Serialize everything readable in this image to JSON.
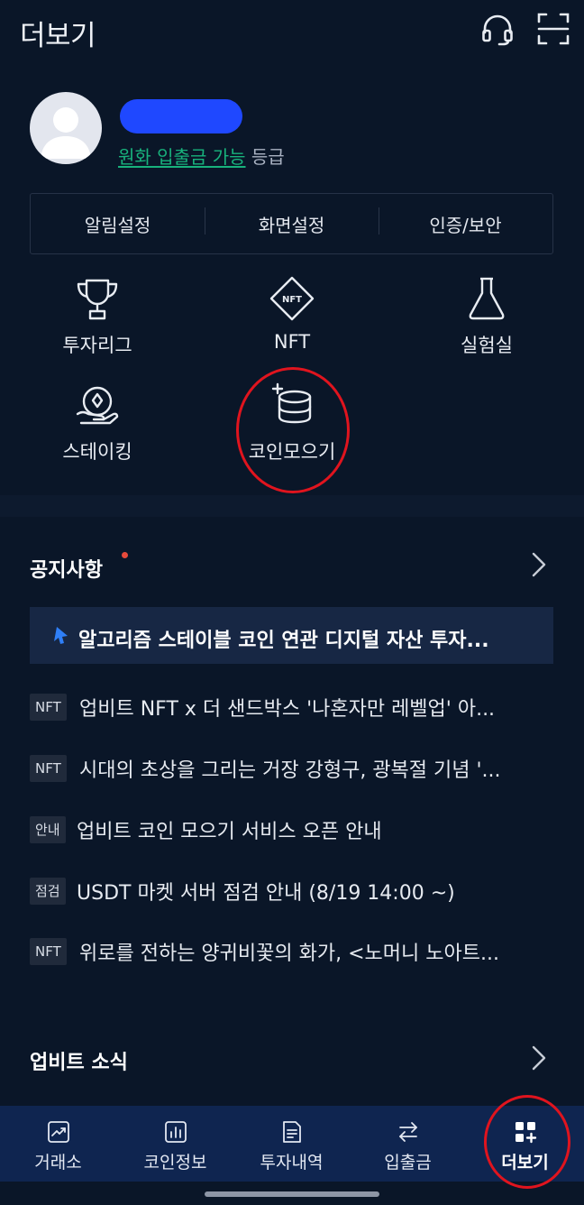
{
  "header": {
    "title": "더보기",
    "support_icon": "headset-icon",
    "scan_icon": "qr-scan-icon"
  },
  "profile": {
    "grade_link": "원화 입출금 가능",
    "grade_suffix": " 등급"
  },
  "settings": [
    "알림설정",
    "화면설정",
    "인증/보안"
  ],
  "features": [
    {
      "label": "투자리그",
      "icon": "trophy-icon"
    },
    {
      "label": "NFT",
      "icon": "nft-icon",
      "icon_text": "NFT"
    },
    {
      "label": "실험실",
      "icon": "flask-icon"
    },
    {
      "label": "스테이킹",
      "icon": "staking-icon"
    },
    {
      "label": "코인모으기",
      "icon": "coin-stack-icon"
    }
  ],
  "notice_section": {
    "title": "공지사항",
    "pinned": "알고리즘 스테이블 코인 연관 디지털 자산 투자...",
    "items": [
      {
        "tag": "NFT",
        "text": "업비트 NFT x 더 샌드박스 '나혼자만 레벨업' 아..."
      },
      {
        "tag": "NFT",
        "text": "시대의 초상을 그리는 거장 강형구, 광복절 기념 '..."
      },
      {
        "tag": "안내",
        "text": "업비트 코인 모으기 서비스 오픈 안내"
      },
      {
        "tag": "점검",
        "text": "USDT 마켓 서버 점검 안내 (8/19 14:00 ~)"
      },
      {
        "tag": "NFT",
        "text": "위로를 전하는 양귀비꽃의 화가, <노머니 노아트..."
      }
    ]
  },
  "news_section": {
    "title": "업비트 소식"
  },
  "tabbar": [
    {
      "label": "거래소",
      "icon": "chart-icon"
    },
    {
      "label": "코인정보",
      "icon": "bar-chart-icon"
    },
    {
      "label": "투자내역",
      "icon": "document-icon"
    },
    {
      "label": "입출금",
      "icon": "transfer-icon"
    },
    {
      "label": "더보기",
      "icon": "more-grid-icon",
      "active": true
    }
  ],
  "colors": {
    "background": "#0a1628",
    "accent_green": "#18b27c",
    "tabbar": "#0f2550",
    "highlight_circle": "#e0141e",
    "pinned_bg": "#172744"
  }
}
